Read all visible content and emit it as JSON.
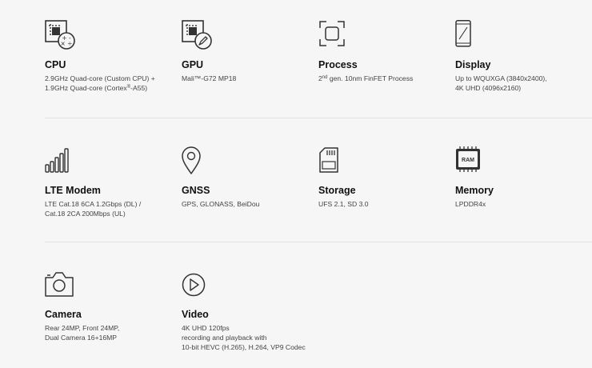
{
  "specs": {
    "cpu": {
      "icon": "cpu-chip-icon",
      "title": "CPU",
      "line1": "2.9GHz Quad-core (Custom CPU) +",
      "line2_pre": "1.9GHz Quad-core (Cortex",
      "line2_sup": "®",
      "line2_post": "-A55)"
    },
    "gpu": {
      "icon": "gpu-chip-icon",
      "title": "GPU",
      "line1": "Mali™-G72 MP18"
    },
    "process": {
      "icon": "process-die-icon",
      "title": "Process",
      "line1_pre": "2",
      "line1_sup": "nd",
      "line1_post": " gen. 10nm FinFET Process"
    },
    "display": {
      "icon": "phone-display-icon",
      "title": "Display",
      "line1": "Up to WQUXGA (3840x2400),",
      "line2": "4K UHD (4096x2160)"
    },
    "lte_modem": {
      "icon": "signal-bars-icon",
      "title": "LTE Modem",
      "line1": "LTE Cat.18 6CA 1.2Gbps (DL) /",
      "line2": "Cat.18 2CA 200Mbps (UL)"
    },
    "gnss": {
      "icon": "location-pin-icon",
      "title": "GNSS",
      "line1": "GPS, GLONASS, BeiDou"
    },
    "storage": {
      "icon": "sd-card-icon",
      "title": "Storage",
      "line1": "UFS 2.1, SD 3.0"
    },
    "memory": {
      "icon": "ram-chip-icon",
      "icon_text": "RAM",
      "title": "Memory",
      "line1": "LPDDR4x"
    },
    "camera": {
      "icon": "camera-icon",
      "title": "Camera",
      "line1": "Rear 24MP, Front 24MP,",
      "line2": "Dual Camera 16+16MP"
    },
    "video": {
      "icon": "play-circle-icon",
      "title": "Video",
      "line1": "4K UHD 120fps",
      "line2": "recording and playback with",
      "line3": "10-bit HEVC (H.265), H.264, VP9 Codec"
    }
  }
}
